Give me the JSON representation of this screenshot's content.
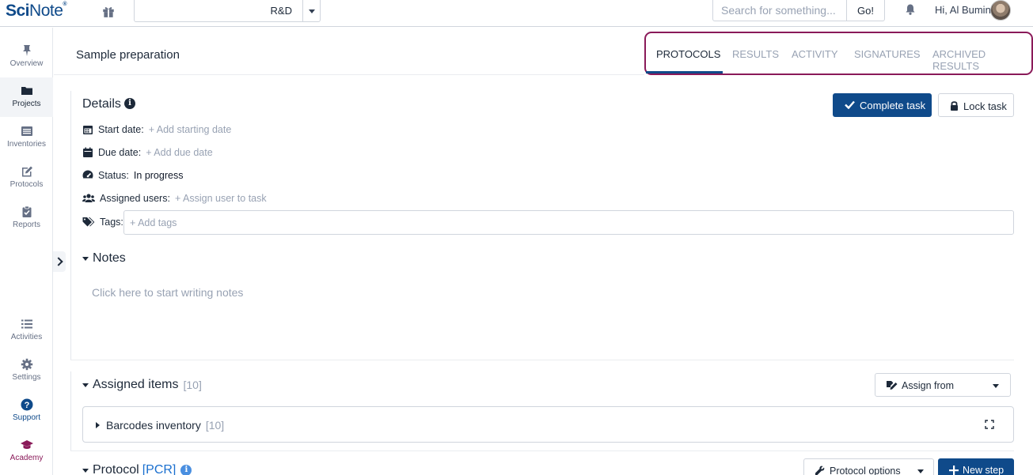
{
  "topbar": {
    "logo_sci": "Sci",
    "logo_note": "Note",
    "logo_tm": "®",
    "team": "R&D",
    "search_placeholder": "Search for something...",
    "go_label": "Go!",
    "greeting": "Hi, Al Bumin"
  },
  "sidebar": {
    "items": [
      {
        "label": "Overview",
        "icon": "pin-icon"
      },
      {
        "label": "Projects",
        "icon": "folder-icon"
      },
      {
        "label": "Inventories",
        "icon": "list-box-icon"
      },
      {
        "label": "Protocols",
        "icon": "edit-icon"
      },
      {
        "label": "Reports",
        "icon": "clipboard-icon"
      }
    ],
    "bottom_items": [
      {
        "label": "Activities",
        "icon": "list-icon"
      },
      {
        "label": "Settings",
        "icon": "gear-icon"
      },
      {
        "label": "Support",
        "icon": "question-icon"
      },
      {
        "label": "Academy",
        "icon": "graduation-cap-icon"
      }
    ]
  },
  "task": {
    "title": "Sample preparation",
    "tabs": [
      {
        "label": "PROTOCOLS",
        "active": true
      },
      {
        "label": "RESULTS"
      },
      {
        "label": "ACTIVITY"
      },
      {
        "label": "SIGNATURES"
      },
      {
        "label": "ARCHIVED RESULTS"
      }
    ]
  },
  "details": {
    "heading": "Details",
    "info_glyph": "i",
    "complete_label": "Complete task",
    "lock_label": "Lock task",
    "start_label": "Start date:",
    "start_value": "+ Add starting date",
    "due_label": "Due date:",
    "due_value": "+ Add due date",
    "status_label": "Status:",
    "status_value": "In progress",
    "users_label": "Assigned users:",
    "users_value": "+ Assign user to task",
    "tags_label": "Tags:",
    "tags_placeholder": "+ Add tags"
  },
  "notes": {
    "heading": "Notes",
    "placeholder": "Click here to start writing notes"
  },
  "assigned": {
    "heading": "Assigned items",
    "count": "[10]",
    "assign_from_label": "Assign from",
    "inventory_name": "Barcodes inventory",
    "inventory_count": "[10]"
  },
  "protocol": {
    "heading": "Protocol",
    "tag": "[PCR]",
    "info_glyph": "i",
    "options_label": "Protocol options",
    "new_step_label": "New step"
  },
  "colors": {
    "brand": "#0f4a8a",
    "highlight_box": "#8a1a59",
    "muted": "#98a2b3"
  }
}
